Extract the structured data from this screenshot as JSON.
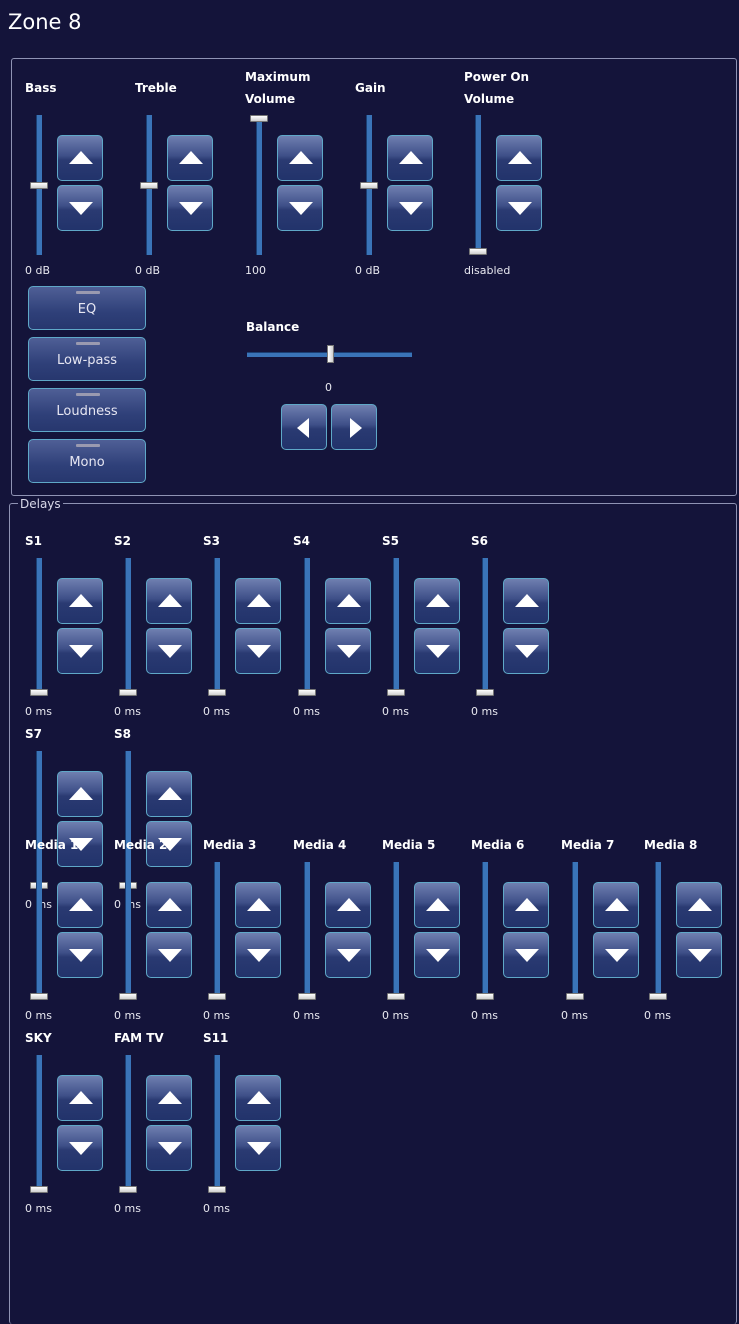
{
  "title": "Zone 8",
  "colors": {
    "background": "#14143a",
    "slider": "#3a74b8",
    "button_border": "#5fa8c8"
  },
  "controls": [
    {
      "label": "Bass",
      "value": "0 dB",
      "level": 0.5
    },
    {
      "label": "Treble",
      "value": "0 dB",
      "level": 0.5
    },
    {
      "label": "Maximum Volume",
      "value": "100",
      "level": 1.0
    },
    {
      "label": "Gain",
      "value": "0 dB",
      "level": 0.5
    },
    {
      "label": "Power On Volume",
      "value": "disabled",
      "level": 0.0
    }
  ],
  "toggles": [
    "EQ",
    "Low-pass",
    "Loudness",
    "Mono"
  ],
  "balance": {
    "label": "Balance",
    "value": "0",
    "level": 0.5
  },
  "delays": {
    "legend": "Delays",
    "items": [
      {
        "label": "S1",
        "value": "0 ms"
      },
      {
        "label": "S2",
        "value": "0 ms"
      },
      {
        "label": "S3",
        "value": "0 ms"
      },
      {
        "label": "S4",
        "value": "0 ms"
      },
      {
        "label": "S5",
        "value": "0 ms"
      },
      {
        "label": "S6",
        "value": "0 ms"
      },
      {
        "label": "S7",
        "value": "0 ms"
      },
      {
        "label": "S8",
        "value": "0 ms"
      },
      {
        "label": "Media 1",
        "value": "0 ms"
      },
      {
        "label": "Media 2",
        "value": "0 ms"
      },
      {
        "label": "Media 3",
        "value": "0 ms"
      },
      {
        "label": "Media 4",
        "value": "0 ms"
      },
      {
        "label": "Media 5",
        "value": "0 ms"
      },
      {
        "label": "Media 6",
        "value": "0 ms"
      },
      {
        "label": "Media 7",
        "value": "0 ms"
      },
      {
        "label": "Media 8",
        "value": "0 ms"
      },
      {
        "label": "SKY",
        "value": "0 ms"
      },
      {
        "label": "FAM TV",
        "value": "0 ms"
      },
      {
        "label": "S11",
        "value": "0 ms"
      }
    ]
  }
}
